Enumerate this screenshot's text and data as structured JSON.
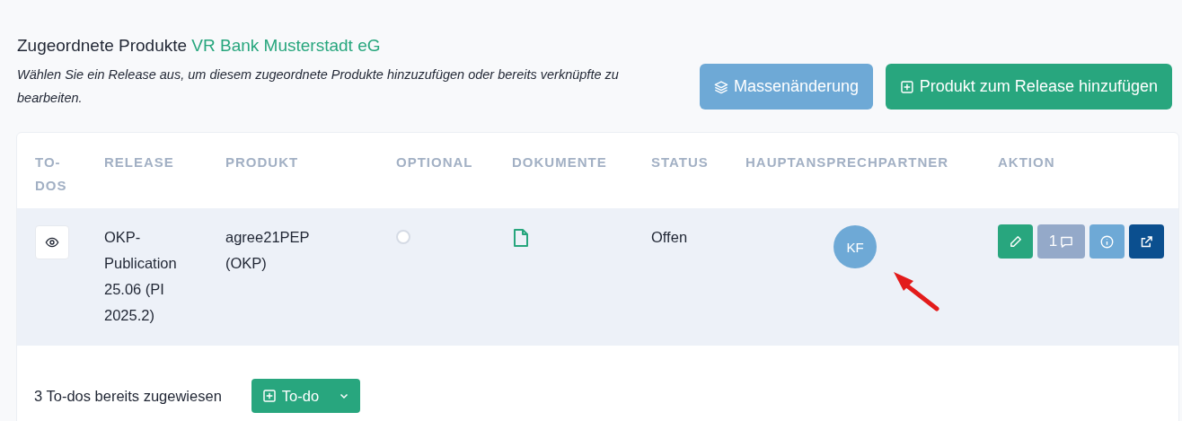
{
  "heading": {
    "title": "Zugeordnete Produkte",
    "bank": "VR Bank Musterstadt eG",
    "description": "Wählen Sie ein Release aus, um diesem zugeordnete Produkte hinzuzufügen oder bereits verknüpfte zu bearbeiten."
  },
  "buttons": [
    {
      "kind": "bulk",
      "label": "Massenänderung"
    },
    {
      "kind": "add",
      "label": "Produkt zum Release hinzufügen"
    }
  ],
  "table": {
    "columns": [
      "TO-DOS",
      "RELEASE",
      "PRODUKT",
      "OPTIONAL",
      "DOKUMENTE",
      "STATUS",
      "HAUPTANSPRECHPARTNER",
      "AKTION"
    ],
    "rows": [
      {
        "release": "OKP-Publication 25.06 (PI 2025.2)",
        "product": "agree21PEP (OKP)",
        "optional": false,
        "status": "Offen",
        "contact": "KF",
        "comments": "1"
      }
    ]
  },
  "footer": {
    "summary": "3 To-dos bereits zugewiesen",
    "todo_button": "To-do"
  }
}
